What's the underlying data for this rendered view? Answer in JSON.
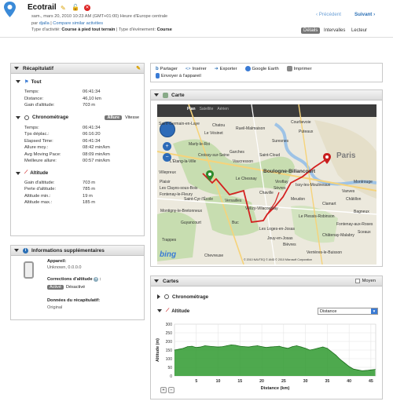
{
  "header": {
    "title": "Ecotrail",
    "date": "sam., mars 20, 2010 10:23 AM (GMT+01:00) Heure d'Europe centrale",
    "by_prefix": "par",
    "author": "djalla",
    "compare_link": "Compare similar activities",
    "activity_type_label": "Type d'activité:",
    "activity_type": "Course à pied tout terrain",
    "event_type_label": "Type d'événement:",
    "event_type": "Course",
    "prev": "Précédent",
    "next": "Suivant",
    "tabs": [
      "Détails",
      "Intervalles",
      "Lecteur"
    ]
  },
  "recap": {
    "title": "Récapitulatif",
    "tout": {
      "title": "Tout",
      "rows": [
        {
          "k": "Temps:",
          "v": "06:41:34"
        },
        {
          "k": "Distance:",
          "v": "46,10 km"
        },
        {
          "k": "Gain d'altitude:",
          "v": "703 m"
        }
      ]
    },
    "chrono": {
      "title": "Chronométrage",
      "toggle_a": "Allure",
      "toggle_b": "Vitesse",
      "rows": [
        {
          "k": "Temps:",
          "v": "06:41:34"
        },
        {
          "k": "Tps déplac.:",
          "v": "06:16:20"
        },
        {
          "k": "Elapsed Time:",
          "v": "06:41:34"
        },
        {
          "k": "Allure moy.:",
          "v": "08:42 min/km"
        },
        {
          "k": "Avg Moving Pace:",
          "v": "08:09 min/km"
        },
        {
          "k": "Meilleure allure:",
          "v": "00:57 min/km"
        }
      ]
    },
    "altitude": {
      "title": "Altitude",
      "rows": [
        {
          "k": "Gain d'altitude:",
          "v": "703 m"
        },
        {
          "k": "Perte d'altitude:",
          "v": "785 m"
        },
        {
          "k": "Altitude min.:",
          "v": "19 m"
        },
        {
          "k": "Altitude max.:",
          "v": "185 m"
        }
      ]
    }
  },
  "info": {
    "title": "Informations supplémentaires",
    "device_label": "Appareil:",
    "device_value": "Unknown, 0.0.0.0",
    "alt_corr_label": "Corrections d'altitude",
    "alt_corr_on": "Activé",
    "alt_corr_off": "Désactivé",
    "recap_data_label": "Données du récapitulatif:",
    "recap_data_value": "Original"
  },
  "toolbar": {
    "share": "Partager",
    "insert": "Insérer",
    "export": "Exporter",
    "google_earth": "Google Earth",
    "print": "Imprimer",
    "send_device": "Envoyer à l'appareil"
  },
  "map": {
    "title": "Carte",
    "types": [
      "Plan",
      "Satellite",
      "Aérien"
    ],
    "labels": [
      "Courbevoie",
      "Puteaux",
      "Suresnes",
      "Saint-Cloud",
      "Boulogne-Billancourt",
      "Paris",
      "Le Chesnay",
      "Versailles",
      "Chaville",
      "Meudon",
      "Vélizy-Villacoublay",
      "Clamart",
      "Montigny-le-Bretonneux",
      "Guyancourt",
      "Saint-Cyr-l'École",
      "Plaisir",
      "Les Clayes-sous-Bois",
      "Fontenay-le-Fleury",
      "Marly-le-Roi",
      "Buc",
      "Le Plessis-Robinson",
      "Châtillon",
      "Vanves",
      "Issy-les-Moulineaux",
      "Bagneux",
      "Fontenay-aux-Roses",
      "Châtenay-Malabry",
      "Sceaux",
      "Montrouge",
      "Trappes",
      "Chevreuse",
      "Viroflay",
      "Les Loges-en-Josas",
      "Jouy-en-Josas",
      "Rueil-Malmaison",
      "Chatou",
      "Saint-Germain-en-Laye",
      "Le Vésinet",
      "Croissy-sur-Seine",
      "Vaucresson",
      "L'Étang-la-Ville",
      "Villepreux",
      "Sèvres",
      "Garches",
      "Bièvres",
      "Verrières-le-Buisson"
    ],
    "logo": "bing",
    "copyright": "© 2010 NAVTEQ © AND © 2010 Microsoft Corporation"
  },
  "charts_panel": {
    "title": "Cartes",
    "moyen": "Moyen",
    "chrono": "Chronométrage",
    "altitude": "Altitude",
    "select_value": "Distance"
  },
  "chart_data": {
    "type": "area",
    "xlabel": "Distance (km)",
    "ylabel": "Altitude (m)",
    "xlim": [
      0,
      46.1
    ],
    "ylim": [
      0,
      300
    ],
    "xticks": [
      5,
      10,
      15,
      20,
      25,
      30,
      35,
      40,
      45
    ],
    "yticks": [
      0,
      50,
      100,
      150,
      200,
      250,
      300
    ],
    "x": [
      0,
      1,
      2,
      3,
      4,
      5,
      6,
      7,
      8,
      9,
      10,
      11,
      12,
      13,
      14,
      15,
      16,
      17,
      18,
      19,
      20,
      21,
      22,
      23,
      24,
      25,
      26,
      27,
      28,
      29,
      30,
      31,
      32,
      33,
      34,
      35,
      36,
      37,
      38,
      39,
      40,
      41,
      42,
      43,
      44,
      45,
      46
    ],
    "y": [
      150,
      155,
      160,
      170,
      172,
      165,
      168,
      175,
      172,
      170,
      168,
      170,
      175,
      180,
      178,
      172,
      170,
      168,
      172,
      175,
      170,
      165,
      168,
      170,
      172,
      165,
      160,
      170,
      175,
      168,
      160,
      150,
      155,
      162,
      168,
      160,
      140,
      120,
      95,
      75,
      55,
      40,
      35,
      30,
      32,
      35,
      38
    ],
    "color": "#2f9a2f"
  },
  "colors": {
    "accent": "#2a6fb5",
    "route": "#d42020",
    "chart_fill": "#2f9a2f",
    "chart_line": "#1d6e1d"
  }
}
